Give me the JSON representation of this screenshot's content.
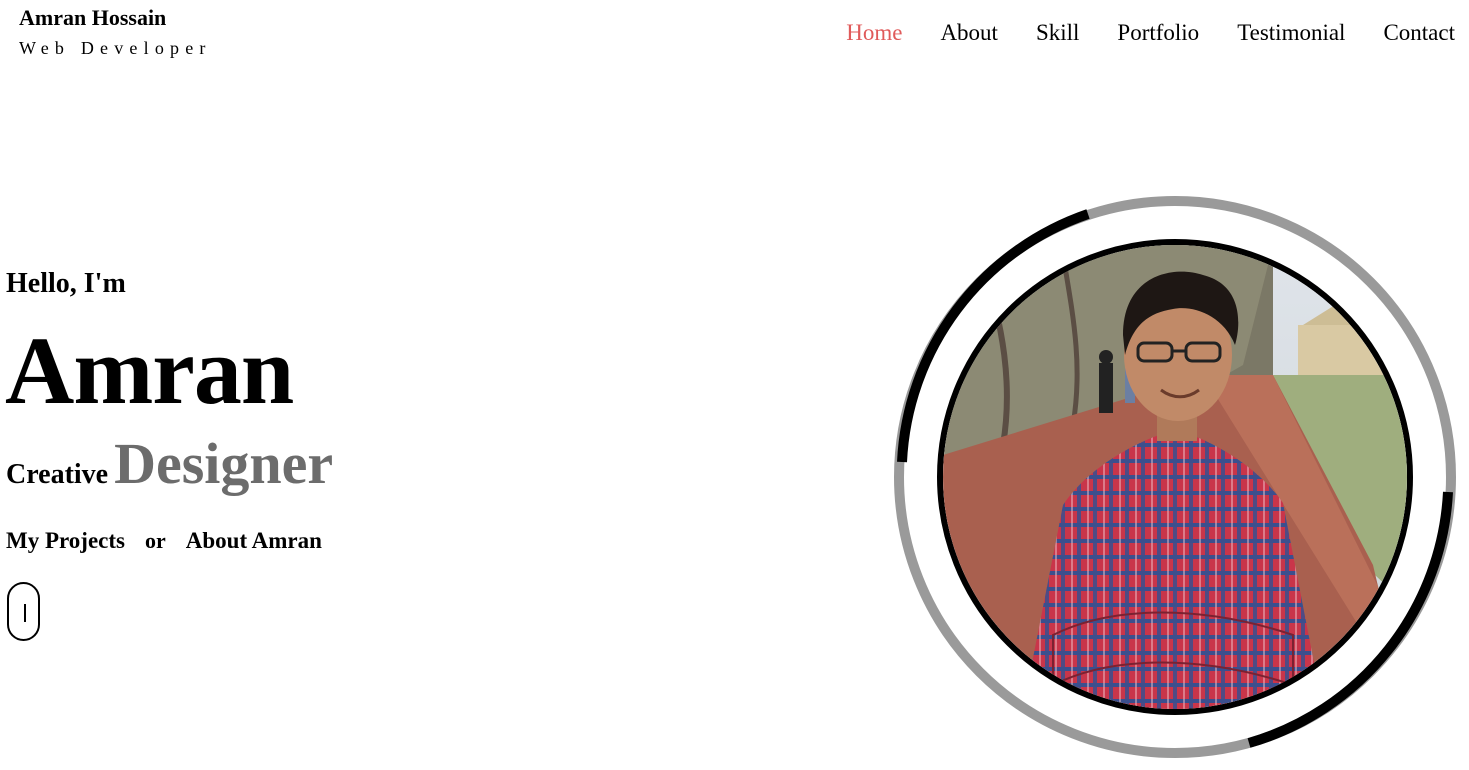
{
  "brand": {
    "name": "Amran Hossain",
    "role": "Web Developer"
  },
  "nav": {
    "items": [
      {
        "label": "Home",
        "active": true
      },
      {
        "label": "About",
        "active": false
      },
      {
        "label": "Skill",
        "active": false
      },
      {
        "label": "Portfolio",
        "active": false
      },
      {
        "label": "Testimonial",
        "active": false
      },
      {
        "label": "Contact",
        "active": false
      }
    ]
  },
  "hero": {
    "greeting": "Hello, I'm",
    "name": "Amran",
    "tag_prefix": "Creative",
    "tag_role": "Designer",
    "link_projects": "My Projects",
    "link_or": "or",
    "link_about": "About Amran"
  },
  "portrait": {
    "icon": "profile-photo",
    "ring_color_light": "#9a9a9a",
    "ring_color_dark": "#000000"
  },
  "colors": {
    "accent": "#e05a5a",
    "muted": "#6c6c6c"
  }
}
